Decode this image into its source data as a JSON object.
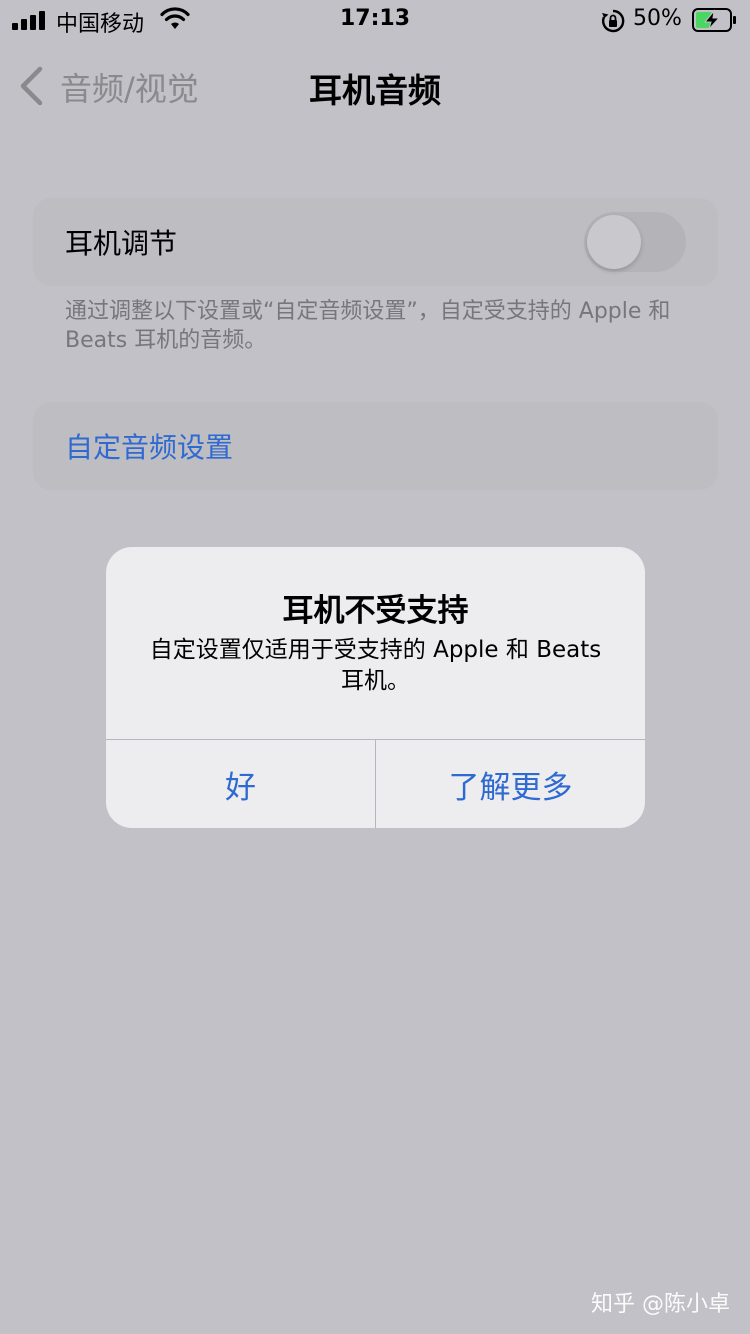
{
  "status_bar": {
    "carrier": "中国移动",
    "time": "17:13",
    "battery_percent": "50%",
    "battery_level": 0.5,
    "icons": [
      "signal-icon",
      "wifi-icon",
      "rotation-lock-icon",
      "battery-charging-icon"
    ]
  },
  "nav": {
    "back_label": "音频/视觉",
    "title": "耳机音频"
  },
  "settings": {
    "headphone_accommodations_label": "耳机调节",
    "headphone_accommodations_on": false,
    "footnote": "通过调整以下设置或“自定音频设置”，自定受支持的 Apple 和 Beats 耳机的音频。",
    "custom_audio_label": "自定音频设置"
  },
  "alert": {
    "title": "耳机不受支持",
    "message": "自定设置仅适用于受支持的 Apple 和 Beats 耳机。",
    "ok_label": "好",
    "learn_more_label": "了解更多"
  },
  "watermark": "知乎 @陈小卓",
  "colors": {
    "link_blue": "#2f6ad0",
    "dimmed_background": "#c2c1c7",
    "alert_background": "#ededf0"
  }
}
